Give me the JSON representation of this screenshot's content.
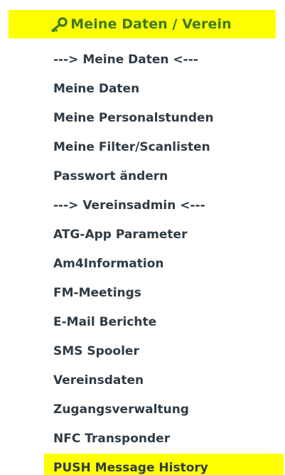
{
  "header": {
    "icon": "key-icon",
    "title": "Meine Daten / Verein",
    "background": "#ffff00",
    "title_color": "#3d7a25"
  },
  "menu": {
    "items": [
      {
        "label": "---> Meine Daten <---",
        "type": "separator"
      },
      {
        "label": "Meine Daten",
        "type": "link"
      },
      {
        "label": "Meine Personalstunden",
        "type": "link"
      },
      {
        "label": "Meine Filter/Scanlisten",
        "type": "link"
      },
      {
        "label": "Passwort ändern",
        "type": "link"
      },
      {
        "label": "---> Vereinsadmin <---",
        "type": "separator"
      },
      {
        "label": "ATG-App Parameter",
        "type": "link"
      },
      {
        "label": "Am4Information",
        "type": "link"
      },
      {
        "label": "FM-Meetings",
        "type": "link"
      },
      {
        "label": "E-Mail Berichte",
        "type": "link"
      },
      {
        "label": "SMS Spooler",
        "type": "link"
      },
      {
        "label": "Vereinsdaten",
        "type": "link"
      },
      {
        "label": "Zugangsverwaltung",
        "type": "link"
      },
      {
        "label": "NFC Transponder",
        "type": "link"
      },
      {
        "label": "PUSH Message History",
        "type": "link",
        "active": true
      }
    ],
    "text_color": "#2f3b45",
    "active_background": "#ffff00"
  }
}
